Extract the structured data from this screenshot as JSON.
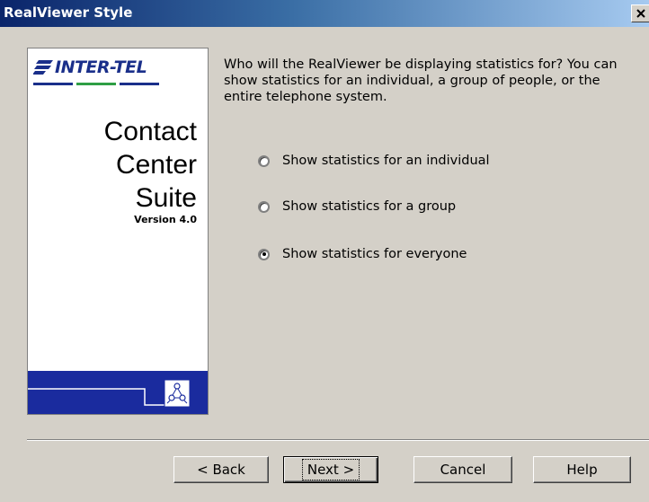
{
  "window": {
    "title": "RealViewer Style"
  },
  "sidebar": {
    "logo_text": "INTER-TEL",
    "brand_lines": [
      "Contact",
      "Center",
      "Suite"
    ],
    "version": "Version 4.0"
  },
  "main": {
    "question": "Who will the RealViewer be displaying statistics for? You can show statistics for an individual, a group of people, or the entire telephone system.",
    "options": [
      {
        "label": "Show statistics for an individual",
        "selected": false
      },
      {
        "label": "Show statistics for a group",
        "selected": false
      },
      {
        "label": "Show statistics for everyone",
        "selected": true
      }
    ]
  },
  "buttons": {
    "back": "< Back",
    "next": "Next >",
    "cancel": "Cancel",
    "help": "Help"
  },
  "colors": {
    "title_start": "#0a246a",
    "title_end": "#a6caf0",
    "panel_band": "#1a2b9e",
    "logo": "#1a2f8a"
  }
}
